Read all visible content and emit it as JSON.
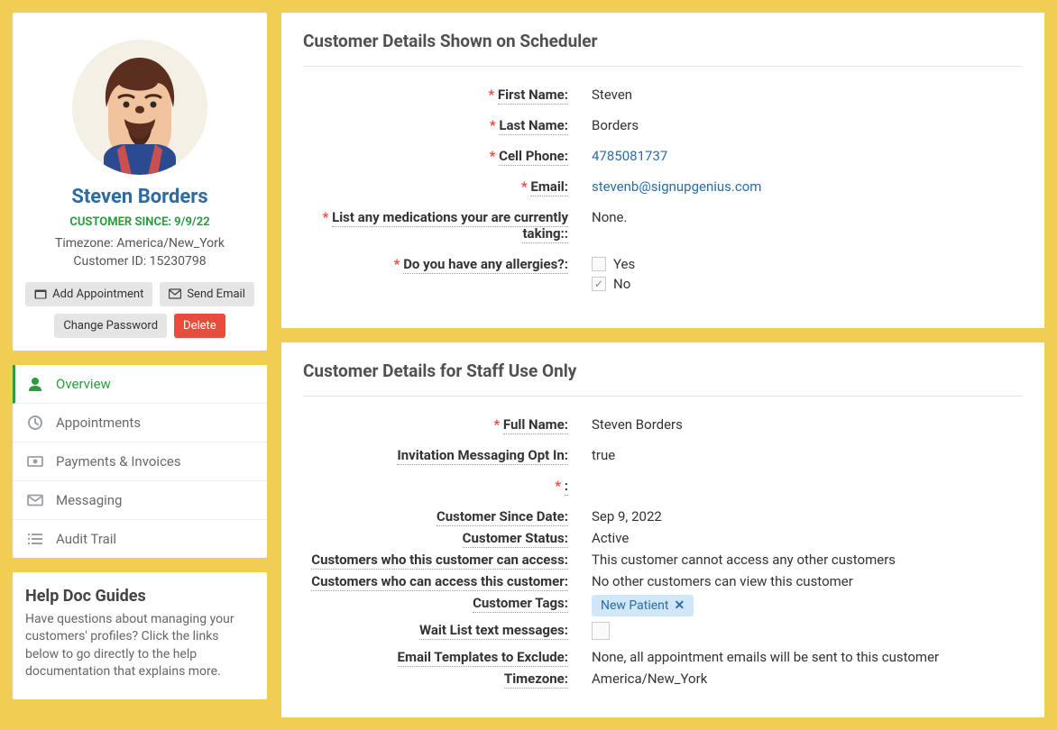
{
  "profile": {
    "name": "Steven Borders",
    "customer_since_label": "CUSTOMER SINCE: 9/9/22",
    "timezone_line": "Timezone: America/New_York",
    "customer_id_line": "Customer ID: 15230798"
  },
  "actions": {
    "add_appointment": "Add Appointment",
    "send_email": "Send Email",
    "change_password": "Change Password",
    "delete": "Delete"
  },
  "nav": {
    "overview": "Overview",
    "appointments": "Appointments",
    "payments": "Payments & Invoices",
    "messaging": "Messaging",
    "audit": "Audit Trail"
  },
  "help": {
    "title": "Help Doc Guides",
    "body": "Have questions about managing your customers' profiles? Click the links below to go directly to the help documentation that explains more."
  },
  "scheduler_panel": {
    "title": "Customer Details Shown on Scheduler",
    "labels": {
      "first_name": "First Name:",
      "last_name": "Last Name:",
      "cell_phone": "Cell Phone:",
      "email": "Email:",
      "medications": "List any medications your are currently taking::",
      "allergies": "Do you have any allergies?:"
    },
    "values": {
      "first_name": "Steven",
      "last_name": "Borders",
      "cell_phone": "4785081737",
      "email": "stevenb@signupgenius.com",
      "medications": "None.",
      "allergy_yes": "Yes",
      "allergy_no": "No"
    }
  },
  "staff_panel": {
    "title": "Customer Details for Staff Use Only",
    "labels": {
      "full_name": "Full Name:",
      "opt_in": "Invitation Messaging Opt In:",
      "blank": ":",
      "since_date": "Customer Since Date:",
      "status": "Customer Status:",
      "can_access": "Customers who this customer can access:",
      "accessed_by": "Customers who can access this customer:",
      "tags": "Customer Tags:",
      "waitlist": "Wait List text messages:",
      "exclude_templates": "Email Templates to Exclude:",
      "timezone": "Timezone:"
    },
    "values": {
      "full_name": "Steven Borders",
      "opt_in": "true",
      "since_date": "Sep 9, 2022",
      "status": "Active",
      "can_access": "This customer cannot access any other customers",
      "accessed_by": "No other customers can view this customer",
      "tag": "New Patient",
      "exclude_templates": "None, all appointment emails will be sent to this customer",
      "timezone": "America/New_York"
    }
  }
}
